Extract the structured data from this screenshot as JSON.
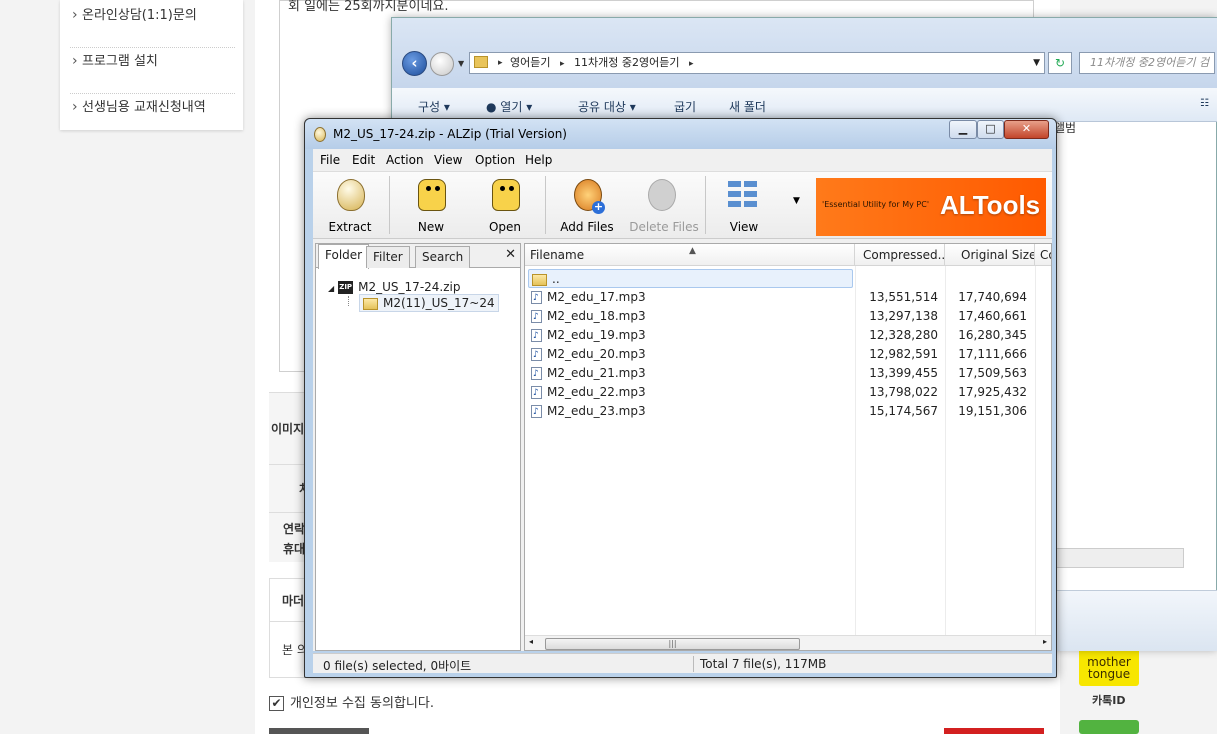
{
  "sidebar": {
    "items": [
      {
        "label": "온라인상담(1:1)문의"
      },
      {
        "label": "프로그램 설치"
      },
      {
        "label": "선생님용 교재신청내역"
      }
    ]
  },
  "page": {
    "textbox_text": "회 일에는 25회까지분이네요.",
    "form_labels": [
      "이미지",
      "처",
      "연락",
      "휴대",
      "마더",
      "본 의"
    ],
    "agree_label": "개인정보 수집 동의합니다.",
    "agree_checked": "✔",
    "mother_tongue": "mother tongue",
    "kakao": "카톡ID"
  },
  "explorer": {
    "breadcrumb": [
      "영어듣기",
      "11차개정 중2영어듣기"
    ],
    "search_placeholder": "11차개정 중2영어듣기 검",
    "toolbar": [
      "구성",
      "열기",
      "공유 대상",
      "굽기",
      "새 폴더"
    ],
    "album_label": "앨범"
  },
  "alzip": {
    "title": "M2_US_17-24.zip - ALZip (Trial Version)",
    "menu": [
      "File",
      "Edit",
      "Action",
      "View",
      "Option",
      "Help"
    ],
    "toolbar": [
      {
        "label": "Extract",
        "icon": "egg-icon"
      },
      {
        "label": "New",
        "icon": "penguin-new-icon"
      },
      {
        "label": "Open",
        "icon": "penguin-open-icon"
      },
      {
        "label": "Add Files",
        "icon": "add-files-icon"
      },
      {
        "label": "Delete Files",
        "icon": "delete-files-icon"
      },
      {
        "label": "View",
        "icon": "view-grid-icon"
      }
    ],
    "banner": {
      "tagline": "'Essential Utility for My PC'",
      "brand": "ALTools"
    },
    "tabs": [
      "Folder",
      "Filter",
      "Search"
    ],
    "tree": {
      "root": "M2_US_17-24.zip",
      "child": "M2(11)_US_17~24"
    },
    "columns": [
      "Filename",
      "Compressed...",
      "Original Size",
      "Co"
    ],
    "parent_row": "..",
    "files": [
      {
        "name": "M2_edu_17.mp3",
        "compressed": "13,551,514",
        "original": "17,740,694"
      },
      {
        "name": "M2_edu_18.mp3",
        "compressed": "13,297,138",
        "original": "17,460,661"
      },
      {
        "name": "M2_edu_19.mp3",
        "compressed": "12,328,280",
        "original": "16,280,345"
      },
      {
        "name": "M2_edu_20.mp3",
        "compressed": "12,982,591",
        "original": "17,111,666"
      },
      {
        "name": "M2_edu_21.mp3",
        "compressed": "13,399,455",
        "original": "17,509,563"
      },
      {
        "name": "M2_edu_22.mp3",
        "compressed": "13,798,022",
        "original": "17,925,432"
      },
      {
        "name": "M2_edu_23.mp3",
        "compressed": "15,174,567",
        "original": "19,151,306"
      }
    ],
    "status_left": "0 file(s) selected, 0바이트",
    "status_right": "Total 7 file(s), 117MB"
  }
}
